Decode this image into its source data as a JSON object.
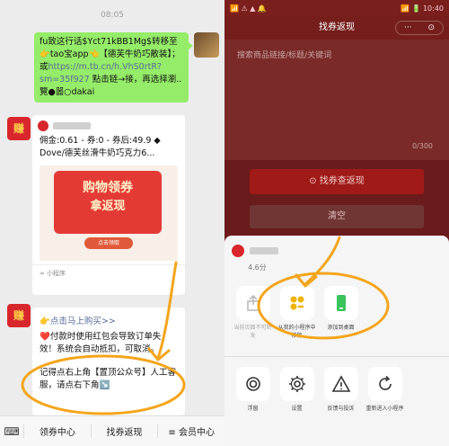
{
  "chat": {
    "timestamp": "08:05",
    "share_message": {
      "prefix": "fu致这行话$Yct71kBB1Mg$转移至👉tao宝app👈【德芙牛奶巧散装】；或",
      "url": "https://m.tb.cn/h.VhS0rtR?sm=35f927",
      "suffix": " 點击链→接，再选择瀏..覽●噐○dakai"
    },
    "card1": {
      "text": "佣金:0.61 - 券:0 - 券后:49.9 ◆ Dove/德芙丝滑牛奶巧克力6...",
      "promo_title": "购物领券",
      "promo_subtitle": "拿返现",
      "promo_button": "点击领取",
      "footer": "小程序"
    },
    "card2": {
      "link": "👉点击马上购买>>",
      "body1": "❤️付款时使用红包会导致订单失效！系统会自动抵扣，可取消。",
      "body2": "记得点右上角【置顶公众号】人工客服，请点右下角↘️"
    }
  },
  "tabbar": {
    "tabs": [
      "领券中心",
      "找券返现",
      "≡ 会员中心"
    ]
  },
  "phone": {
    "status_left": "📶 ⚠ ▲ 🔔",
    "status_right": "📶 🔋 10:40",
    "title": "找券返现",
    "capsule_dots": "···",
    "capsule_target": "⊙",
    "search_placeholder": "搜索商品链接/标题/关键词",
    "char_count": "0/300",
    "search_button": "找券查返现",
    "clear_button": "清空"
  },
  "sheet": {
    "rating": "4.6分",
    "row1": [
      {
        "label": "当前页面不可转发",
        "icon": "share-icon",
        "dim": true
      },
      {
        "label": "从我的小程序中移除",
        "icon": "grid-icon",
        "dim": false
      },
      {
        "label": "添加到桌面",
        "icon": "phone-icon",
        "dim": false
      }
    ],
    "row2": [
      {
        "label": "浮窗",
        "icon": "float-icon"
      },
      {
        "label": "设置",
        "icon": "gear-icon"
      },
      {
        "label": "反馈与投诉",
        "icon": "warning-icon"
      },
      {
        "label": "重新进入小程序",
        "icon": "refresh-icon"
      }
    ]
  }
}
